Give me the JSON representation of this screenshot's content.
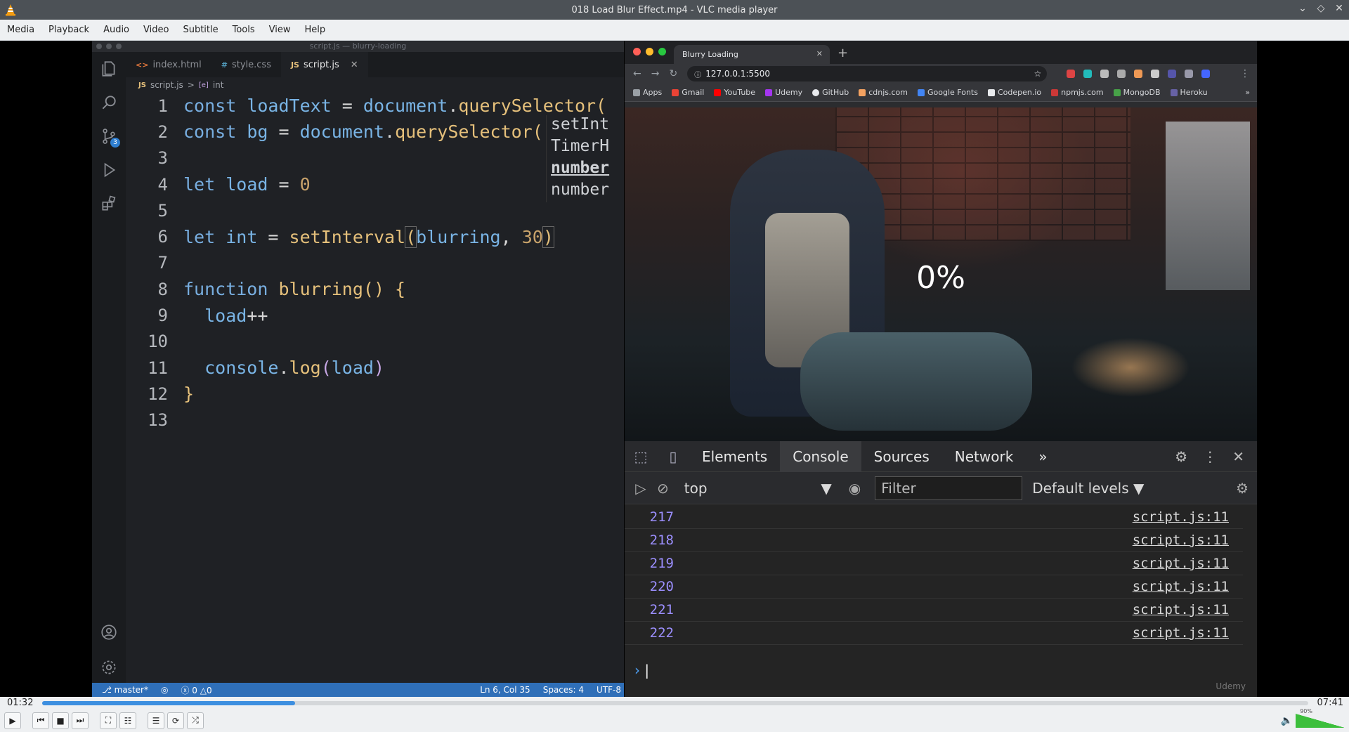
{
  "window": {
    "title": "018 Load Blur Effect.mp4 - VLC media player"
  },
  "menu": [
    "Media",
    "Playback",
    "Audio",
    "Video",
    "Subtitle",
    "Tools",
    "View",
    "Help"
  ],
  "editor": {
    "window_title": "script.js — blurry-loading",
    "tabs": [
      {
        "icon": "<>",
        "label": "index.html",
        "active": false
      },
      {
        "icon": "#",
        "label": "style.css",
        "active": false
      },
      {
        "icon": "JS",
        "label": "script.js",
        "active": true
      }
    ],
    "breadcrumb": {
      "file": "script.js",
      "sep": ">",
      "symbol": "int"
    },
    "lines": [
      "1",
      "2",
      "3",
      "4",
      "5",
      "6",
      "7",
      "8",
      "9",
      "10",
      "11",
      "12",
      "13"
    ],
    "hint": [
      "setInt",
      "TimerH",
      "number",
      "number"
    ],
    "status": {
      "branch": "master*",
      "problems": "0 △0",
      "position": "Ln 6, Col 35",
      "spaces": "Spaces: 4",
      "encoding": "UTF-8"
    },
    "scm_badge": "3"
  },
  "browser": {
    "tab_title": "Blurry Loading",
    "url": "127.0.0.1:5500",
    "bookmarks": [
      {
        "label": "Apps",
        "color": "#9aa0a6"
      },
      {
        "label": "Gmail",
        "color": "#ea4335"
      },
      {
        "label": "YouTube",
        "color": "#ff0000"
      },
      {
        "label": "Udemy",
        "color": "#a435f0"
      },
      {
        "label": "GitHub",
        "color": "#e8eaed"
      },
      {
        "label": "cdnjs.com",
        "color": "#f4a261"
      },
      {
        "label": "Google Fonts",
        "color": "#4285f4"
      },
      {
        "label": "Codepen.io",
        "color": "#e8eaed"
      },
      {
        "label": "npmjs.com",
        "color": "#cb3837"
      },
      {
        "label": "MongoDB",
        "color": "#47a248"
      },
      {
        "label": "Heroku",
        "color": "#6762a6"
      }
    ],
    "page_percent": "0%"
  },
  "devtools": {
    "tabs": [
      "Elements",
      "Console",
      "Sources",
      "Network"
    ],
    "active_tab": "Console",
    "context": "top",
    "filter_placeholder": "Filter",
    "levels": "Default levels ▼",
    "logs": [
      {
        "value": "217",
        "source": "script.js:11"
      },
      {
        "value": "218",
        "source": "script.js:11"
      },
      {
        "value": "219",
        "source": "script.js:11"
      },
      {
        "value": "220",
        "source": "script.js:11"
      },
      {
        "value": "221",
        "source": "script.js:11"
      },
      {
        "value": "222",
        "source": "script.js:11"
      }
    ],
    "watermark": "Udemy"
  },
  "player": {
    "elapsed": "01:32",
    "duration": "07:41",
    "progress_fraction": 0.2,
    "volume": "90%"
  },
  "colors": {
    "accent": "#3d8fe0",
    "vscode_status": "#2f6fb8",
    "console_number": "#9c8fff"
  }
}
